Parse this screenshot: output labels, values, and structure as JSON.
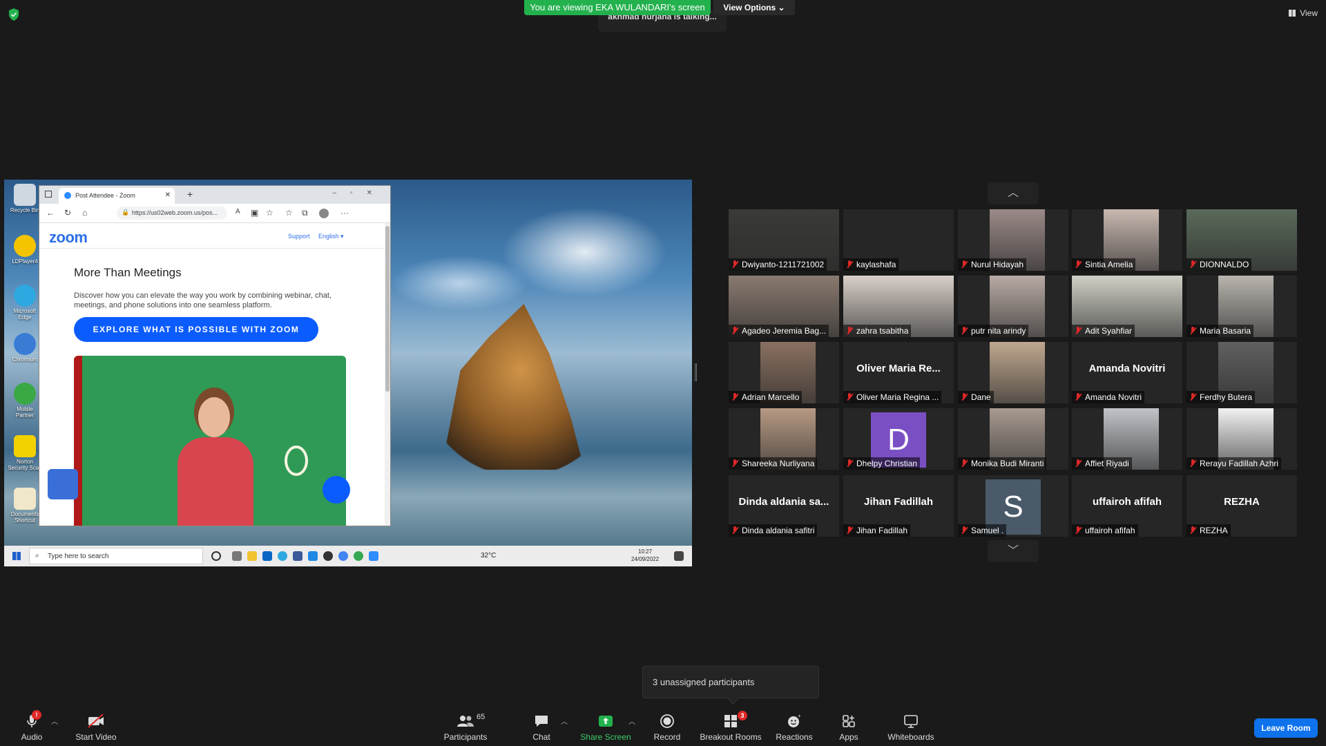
{
  "top": {
    "viewing_banner": "You are viewing EKA WULANDARI's screen",
    "view_options": "View Options",
    "talking": "akhmad nurjana is talking...",
    "view_label": "View"
  },
  "shared_screen": {
    "desktop_icons": [
      "Recycle Bin",
      "LDPlayer4",
      "Microsoft Edge",
      "Chromium",
      "Mobile Partner",
      "Norton Security Scan",
      "Documents Shortcut"
    ],
    "browser": {
      "tab_title": "Post Attendee - Zoom",
      "url": "https://us02web.zoom.us/pos...",
      "logo": "zoom",
      "support": "Support",
      "language": "English",
      "headline": "More Than Meetings",
      "body": "Discover how you can elevate the way you work by combining webinar, chat, meetings, and phone solutions into one seamless platform.",
      "cta": "EXPLORE WHAT IS POSSIBLE WITH ZOOM"
    },
    "taskbar": {
      "search_placeholder": "Type here to search",
      "temperature": "32°C",
      "time": "10:27",
      "date": "24/09/2022"
    }
  },
  "gallery": {
    "participants": [
      {
        "name": "Dwiyanto-1211721002",
        "big": "",
        "type": "video",
        "color": "#3a3a38"
      },
      {
        "name": "kaylashafa",
        "big": "",
        "type": "blank",
        "color": "#262626"
      },
      {
        "name": "Nurul Hidayah",
        "big": "",
        "type": "video",
        "color": "#9b8a88"
      },
      {
        "name": "Sintia Amelia",
        "big": "",
        "type": "video",
        "color": "#c9b8b0"
      },
      {
        "name": "DIONNALDO",
        "big": "",
        "type": "video",
        "color": "#5a6a5a"
      },
      {
        "name": "Agadeo Jeremia Bag...",
        "big": "",
        "type": "video",
        "color": "#8a7a70"
      },
      {
        "name": "zahra tsabitha",
        "big": "",
        "type": "video",
        "color": "#d8cfc8"
      },
      {
        "name": "putr nita arindy",
        "big": "",
        "type": "video",
        "color": "#b8aaa4"
      },
      {
        "name": "Adit Syahfiar",
        "big": "",
        "type": "video",
        "color": "#d0d0c6"
      },
      {
        "name": "Maria Basaria",
        "big": "",
        "type": "video",
        "color": "#b8b4ae"
      },
      {
        "name": "Adrian Marcello",
        "big": "",
        "type": "video",
        "color": "#8a7060"
      },
      {
        "name": "Oliver Maria Regina ...",
        "big": "Oliver Maria Re...",
        "type": "name",
        "color": "#262626"
      },
      {
        "name": "Dane",
        "big": "",
        "type": "video",
        "color": "#c0a890"
      },
      {
        "name": "Amanda Novitri",
        "big": "Amanda Novitri",
        "type": "name",
        "color": "#262626"
      },
      {
        "name": "Ferdhy Butera",
        "big": "",
        "type": "video",
        "color": "#606060"
      },
      {
        "name": "Shareeka Nurliyana",
        "big": "",
        "type": "video",
        "color": "#b89a84"
      },
      {
        "name": "Dhelpy Christian",
        "big": "D",
        "type": "avatar",
        "color": "#7b4fc4"
      },
      {
        "name": "Monika Budi Miranti",
        "big": "",
        "type": "video",
        "color": "#a89a90"
      },
      {
        "name": "Affiet Riyadi",
        "big": "",
        "type": "video",
        "color": "#c0c4c8"
      },
      {
        "name": "Rerayu Fadillah Azhri",
        "big": "",
        "type": "video",
        "color": "#f2f2f2"
      },
      {
        "name": "Dinda aldania safitri",
        "big": "Dinda aldania sa...",
        "type": "name",
        "color": "#262626"
      },
      {
        "name": "Jihan Fadillah",
        "big": "Jihan Fadillah",
        "type": "name",
        "color": "#262626"
      },
      {
        "name": "Samuel .",
        "big": "S",
        "type": "avatar",
        "color": "#4a5a68"
      },
      {
        "name": "uffairoh afifah",
        "big": "uffairoh afifah",
        "type": "name",
        "color": "#262626"
      },
      {
        "name": "REZHA",
        "big": "REZHA",
        "type": "name",
        "color": "#262626"
      }
    ]
  },
  "popup": {
    "unassigned": "3 unassigned participants"
  },
  "toolbar": {
    "audio": "Audio",
    "audio_badge": "!",
    "start_video": "Start Video",
    "participants": "Participants",
    "participants_count": "65",
    "chat": "Chat",
    "share_screen": "Share Screen",
    "record": "Record",
    "breakout_rooms": "Breakout Rooms",
    "breakout_badge": "3",
    "reactions": "Reactions",
    "apps": "Apps",
    "whiteboards": "Whiteboards",
    "leave": "Leave Room"
  },
  "colors": {
    "accent": "#0e72ed",
    "share_green": "#23b14d",
    "muted_red": "#e02828"
  }
}
